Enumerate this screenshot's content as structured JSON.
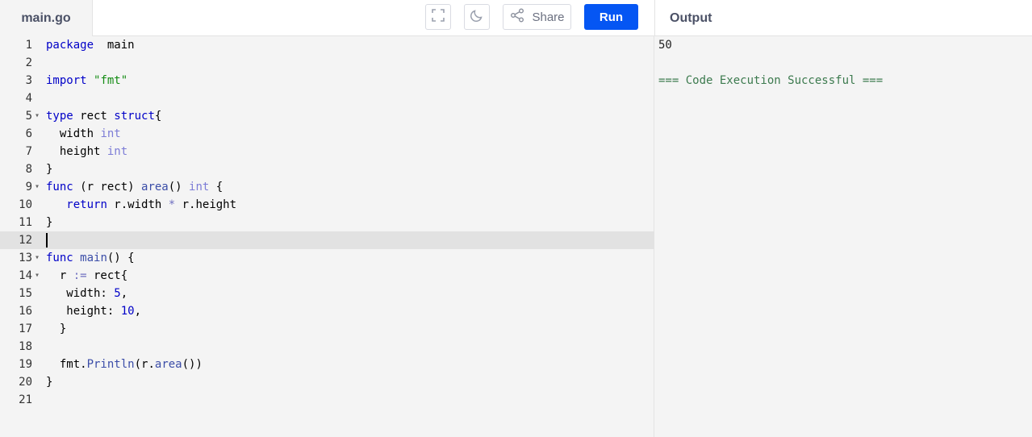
{
  "header": {
    "file_tab": "main.go",
    "share_label": "Share",
    "run_label": "Run",
    "output_title": "Output",
    "icons": [
      "fullscreen-icon",
      "moon-icon",
      "share-icon"
    ]
  },
  "editor": {
    "active_line": 12,
    "lines": [
      {
        "n": "1",
        "tokens": [
          [
            "kw",
            "package"
          ],
          [
            "",
            "  main"
          ]
        ]
      },
      {
        "n": "2",
        "tokens": []
      },
      {
        "n": "3",
        "tokens": [
          [
            "kw",
            "import"
          ],
          [
            "",
            " "
          ],
          [
            "str",
            "\"fmt\""
          ]
        ]
      },
      {
        "n": "4",
        "tokens": []
      },
      {
        "n": "5",
        "fold": true,
        "tokens": [
          [
            "kw",
            "type"
          ],
          [
            "",
            " rect "
          ],
          [
            "kw",
            "struct"
          ],
          [
            "",
            "{"
          ]
        ]
      },
      {
        "n": "6",
        "tokens": [
          [
            "",
            "  width "
          ],
          [
            "tp",
            "int"
          ]
        ]
      },
      {
        "n": "7",
        "tokens": [
          [
            "",
            "  height "
          ],
          [
            "tp",
            "int"
          ]
        ]
      },
      {
        "n": "8",
        "tokens": [
          [
            "",
            "}"
          ]
        ]
      },
      {
        "n": "9",
        "fold": true,
        "tokens": [
          [
            "kw",
            "func"
          ],
          [
            "",
            " (r rect) "
          ],
          [
            "fn",
            "area"
          ],
          [
            "",
            "() "
          ],
          [
            "tp",
            "int"
          ],
          [
            "",
            " {"
          ]
        ]
      },
      {
        "n": "10",
        "tokens": [
          [
            "",
            "   "
          ],
          [
            "kw",
            "return"
          ],
          [
            "",
            " r.width "
          ],
          [
            "op",
            "*"
          ],
          [
            "",
            " r.height"
          ]
        ]
      },
      {
        "n": "11",
        "tokens": [
          [
            "",
            "}"
          ]
        ]
      },
      {
        "n": "12",
        "tokens": []
      },
      {
        "n": "13",
        "fold": true,
        "tokens": [
          [
            "kw",
            "func"
          ],
          [
            "",
            " "
          ],
          [
            "fn",
            "main"
          ],
          [
            "",
            "() {"
          ]
        ]
      },
      {
        "n": "14",
        "fold": true,
        "tokens": [
          [
            "",
            "  r "
          ],
          [
            "op",
            ":="
          ],
          [
            "",
            " rect{"
          ]
        ]
      },
      {
        "n": "15",
        "tokens": [
          [
            "",
            "   width: "
          ],
          [
            "num",
            "5"
          ],
          [
            "",
            ","
          ]
        ]
      },
      {
        "n": "16",
        "tokens": [
          [
            "",
            "   height: "
          ],
          [
            "num",
            "10"
          ],
          [
            "",
            ","
          ]
        ]
      },
      {
        "n": "17",
        "tokens": [
          [
            "",
            "  }"
          ]
        ]
      },
      {
        "n": "18",
        "tokens": []
      },
      {
        "n": "19",
        "tokens": [
          [
            "",
            "  fmt."
          ],
          [
            "fn",
            "Println"
          ],
          [
            "",
            "(r."
          ],
          [
            "fn",
            "area"
          ],
          [
            "",
            "())"
          ]
        ]
      },
      {
        "n": "20",
        "tokens": [
          [
            "",
            "}"
          ]
        ]
      },
      {
        "n": "21",
        "tokens": []
      }
    ]
  },
  "output": {
    "lines": [
      {
        "text": "50",
        "style": "normal"
      },
      {
        "text": "",
        "style": "normal"
      },
      {
        "text": "=== Code Execution Successful ===",
        "style": "success"
      }
    ]
  },
  "colors": {
    "run_button": "#0556f3",
    "keyword": "#0000c8",
    "type": "#7c7cd6",
    "string": "#148c14",
    "success": "#3c7a4e"
  }
}
